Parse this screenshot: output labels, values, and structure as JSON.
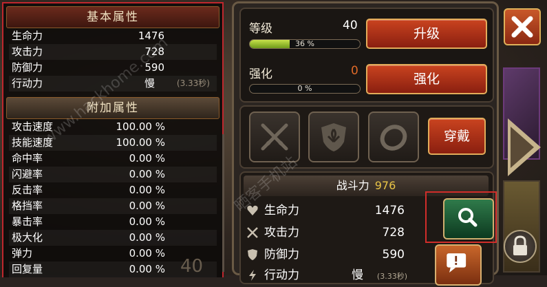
{
  "stats": {
    "base_title": "基本属性",
    "base_rows": [
      {
        "label": "生命力",
        "value": "1476"
      },
      {
        "label": "攻击力",
        "value": "728"
      },
      {
        "label": "防御力",
        "value": "590"
      },
      {
        "label": "行动力",
        "value": "慢",
        "note": "(3.33秒)"
      }
    ],
    "extra_title": "附加属性",
    "extra_rows": [
      {
        "label": "攻击速度",
        "value": "100.00 %"
      },
      {
        "label": "技能速度",
        "value": "100.00 %"
      },
      {
        "label": "命中率",
        "value": "0.00 %"
      },
      {
        "label": "闪避率",
        "value": "0.00 %"
      },
      {
        "label": "反击率",
        "value": "0.00 %"
      },
      {
        "label": "格挡率",
        "value": "0.00 %"
      },
      {
        "label": "暴击率",
        "value": "0.00 %"
      },
      {
        "label": "极大化",
        "value": "0.00 %"
      },
      {
        "label": "弹力",
        "value": "0.00 %"
      },
      {
        "label": "回复量",
        "value": "0.00 %"
      }
    ],
    "ghost_level": "40"
  },
  "upgrade": {
    "level_label": "等级",
    "level_value": "40",
    "level_progress_text": "36 %",
    "level_progress": 0.36,
    "upgrade_button": "升级",
    "enhance_label": "强化",
    "enhance_value": "0",
    "enhance_progress_text": "0 %",
    "enhance_progress": 0,
    "enhance_button": "强化"
  },
  "equip": {
    "slot_icons": [
      "crossed-swords-icon",
      "fleur-shield-icon",
      "ring-icon"
    ],
    "equip_button": "穿戴"
  },
  "combat": {
    "power_label": "战斗力",
    "power_value": "976",
    "rows": [
      {
        "icon": "heart-icon",
        "label": "生命力",
        "value": "1476"
      },
      {
        "icon": "swords-icon",
        "label": "攻击力",
        "value": "728"
      },
      {
        "icon": "shield-icon",
        "label": "防御力",
        "value": "590"
      },
      {
        "icon": "lightning-icon",
        "label": "行动力",
        "value": "慢",
        "note": "(3.33秒)"
      }
    ]
  },
  "watermark": {
    "text1": "www.hackhome.com",
    "text2": "晒客手机站"
  },
  "colors": {
    "accent_red": "#c9431f",
    "power_gold": "#e8c446",
    "progress_green": "#8ec232",
    "highlight_red": "#d12d2a"
  }
}
